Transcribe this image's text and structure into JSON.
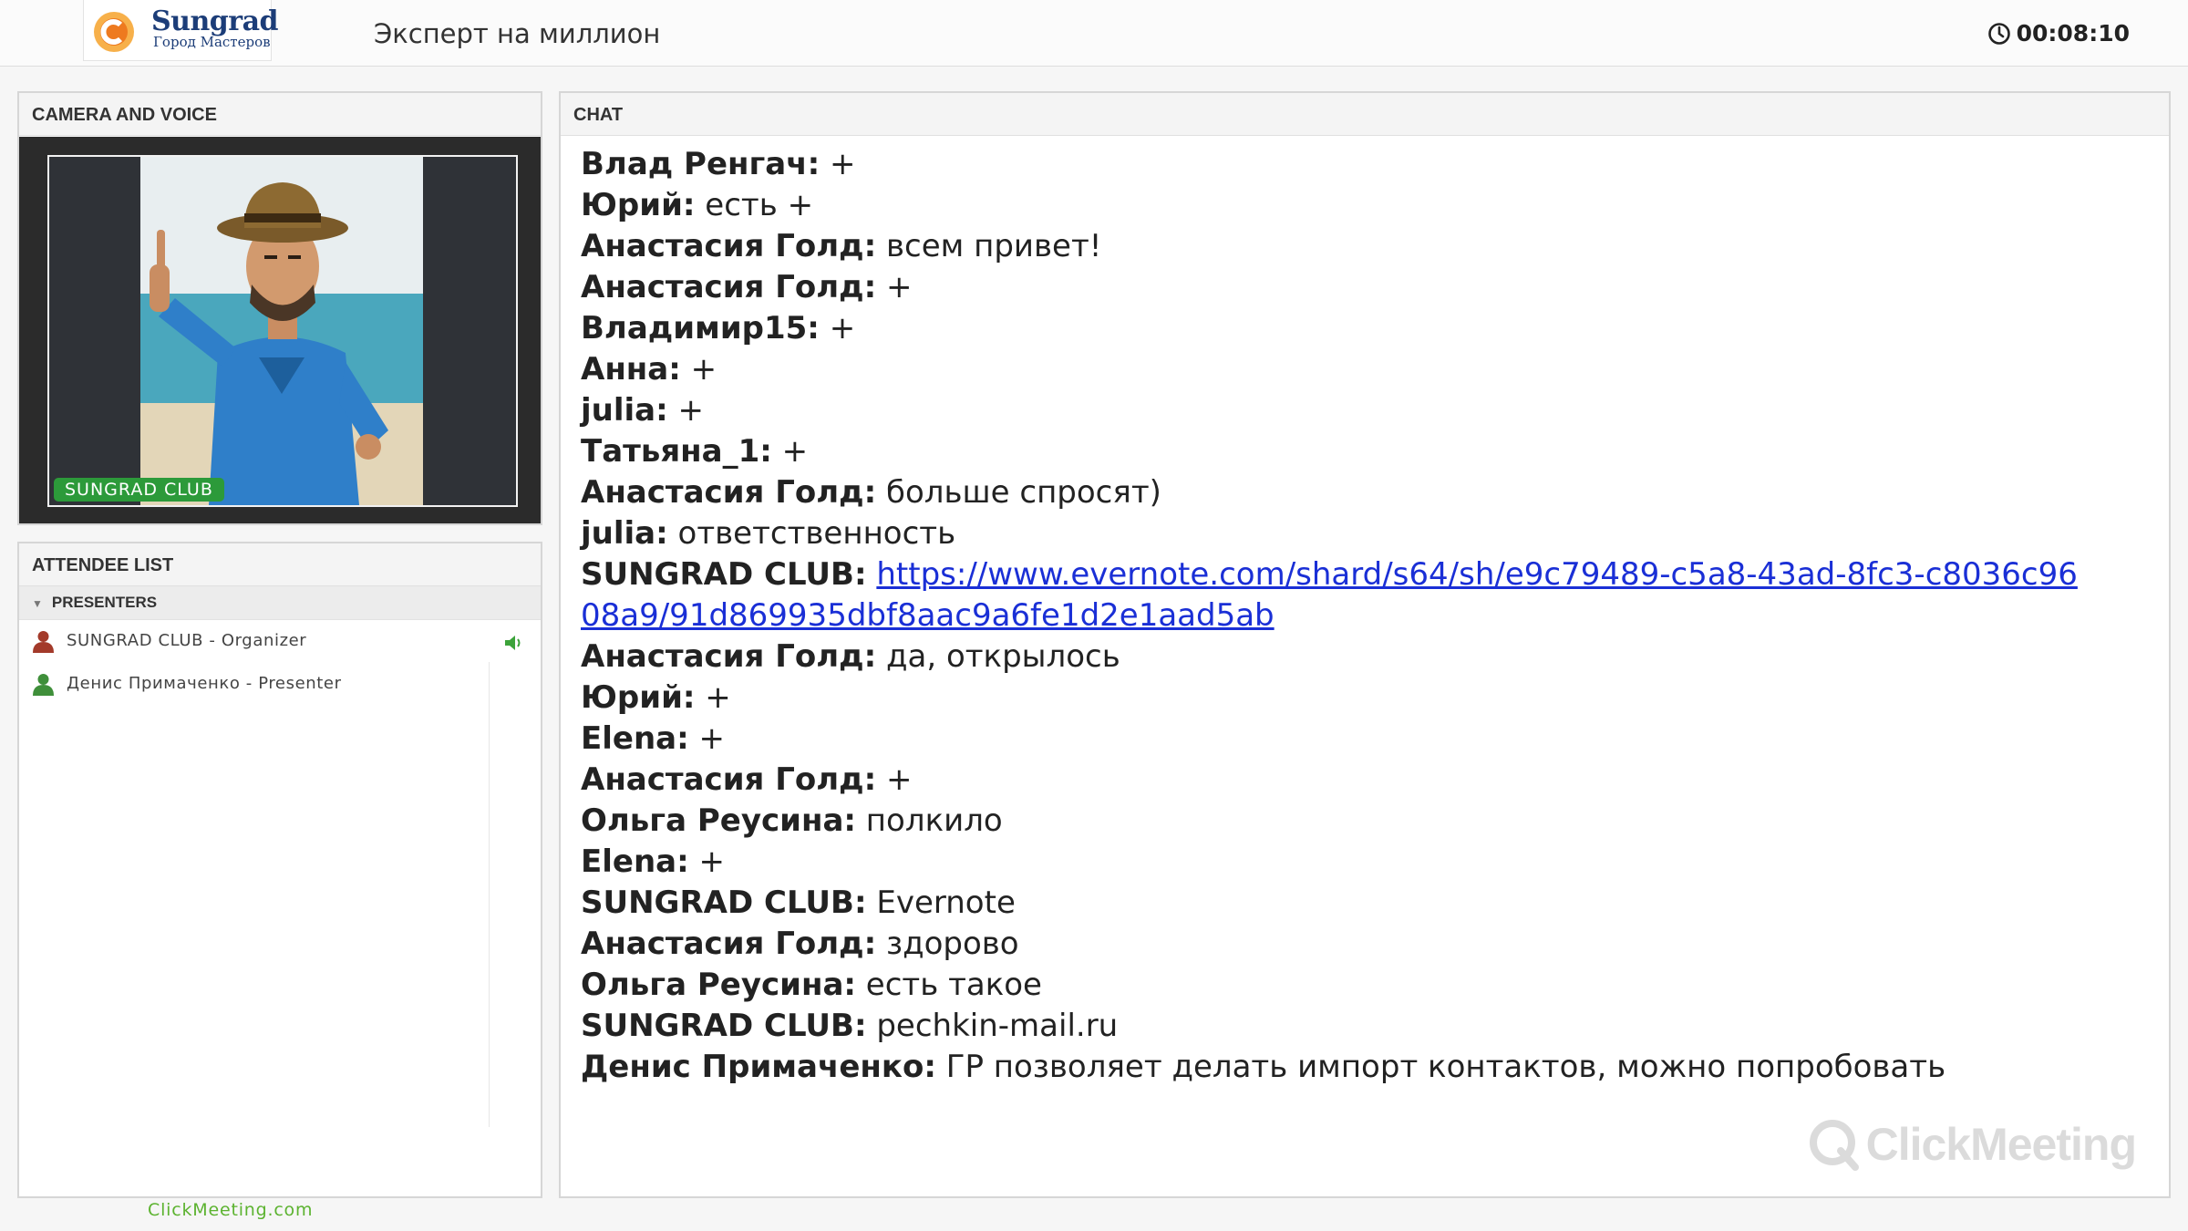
{
  "header": {
    "logo_name": "Sungrad",
    "logo_sub": "Город Мастеров",
    "meeting_title": "Эксперт на миллион",
    "timer": "00:08:10"
  },
  "camera": {
    "title": "CAMERA AND VOICE",
    "badge": "SUNGRAD CLUB"
  },
  "attendees": {
    "title": "ATTENDEE LIST",
    "group": "PRESENTERS",
    "items": [
      {
        "label": "SUNGRAD CLUB - Organizer",
        "icon": "organizer-icon",
        "speaking": true
      },
      {
        "label": "Денис Примаченко - Presenter",
        "icon": "presenter-icon",
        "speaking": false
      }
    ]
  },
  "footer": {
    "link": "ClickMeeting.com"
  },
  "chat": {
    "title": "CHAT",
    "watermark": "ClickMeeting",
    "messages": [
      {
        "author": "Влад Ренгач:",
        "text": " +"
      },
      {
        "author": "Юрий:",
        "text": " есть +"
      },
      {
        "author": "Анастасия Голд:",
        "text": " всем привет!"
      },
      {
        "author": "Анастасия Голд:",
        "text": " +"
      },
      {
        "author": "Владимир15:",
        "text": " +"
      },
      {
        "author": "Анна:",
        "text": " +"
      },
      {
        "author": "julia:",
        "text": " +"
      },
      {
        "author": "Татьяна_1:",
        "text": " +"
      },
      {
        "author": "Анастасия Голд:",
        "text": " больше спросят)"
      },
      {
        "author": "julia:",
        "text": " ответственность"
      },
      {
        "author": "SUNGRAD CLUB:",
        "text": " ",
        "link": "https://www.evernote.com/shard/s64/sh/e9c79489-c5a8-43ad-8fc3-c8036c9608a9/91d869935dbf8aac9a6fe1d2e1aad5ab"
      },
      {
        "author": "Анастасия Голд:",
        "text": " да, открылось"
      },
      {
        "author": "Юрий:",
        "text": " +"
      },
      {
        "author": "Elena:",
        "text": " +"
      },
      {
        "author": "Анастасия Голд:",
        "text": " +"
      },
      {
        "author": "Ольга Реусина:",
        "text": " полкило"
      },
      {
        "author": "Elena:",
        "text": " +"
      },
      {
        "author": "SUNGRAD CLUB:",
        "text": " Evernote"
      },
      {
        "author": "Анастасия Голд:",
        "text": " здорово"
      },
      {
        "author": "Ольга Реусина:",
        "text": " есть такое"
      },
      {
        "author": "SUNGRAD CLUB:",
        "text": " pechkin-mail.ru"
      },
      {
        "author": "Денис Примаченко:",
        "text": " ГР позволяет делать импорт контактов, можно попробовать"
      }
    ]
  },
  "colors": {
    "link": "#1a2fd6",
    "badge": "#2c9a3a",
    "footer_link": "#5cb330",
    "organizer_icon": "#a33a2a",
    "presenter_icon": "#3f8f3a"
  }
}
